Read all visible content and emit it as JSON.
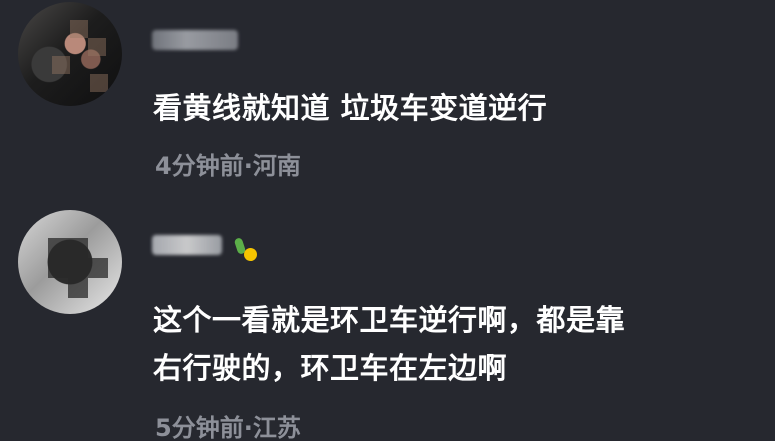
{
  "comments": [
    {
      "text": "看黄线就知道 垃圾车变道逆行",
      "time_location": "4分钟前·河南"
    },
    {
      "text_line1": "这个一看就是环卫车逆行啊，都是靠",
      "text_line2": "右行驶的，环卫车在左边啊",
      "time_location": "5分钟前·江苏",
      "badge_icon": "leaf-sun-badge-icon"
    }
  ],
  "colors": {
    "background": "#26282f",
    "text_primary": "#ffffff",
    "text_secondary": "#8d9099"
  }
}
